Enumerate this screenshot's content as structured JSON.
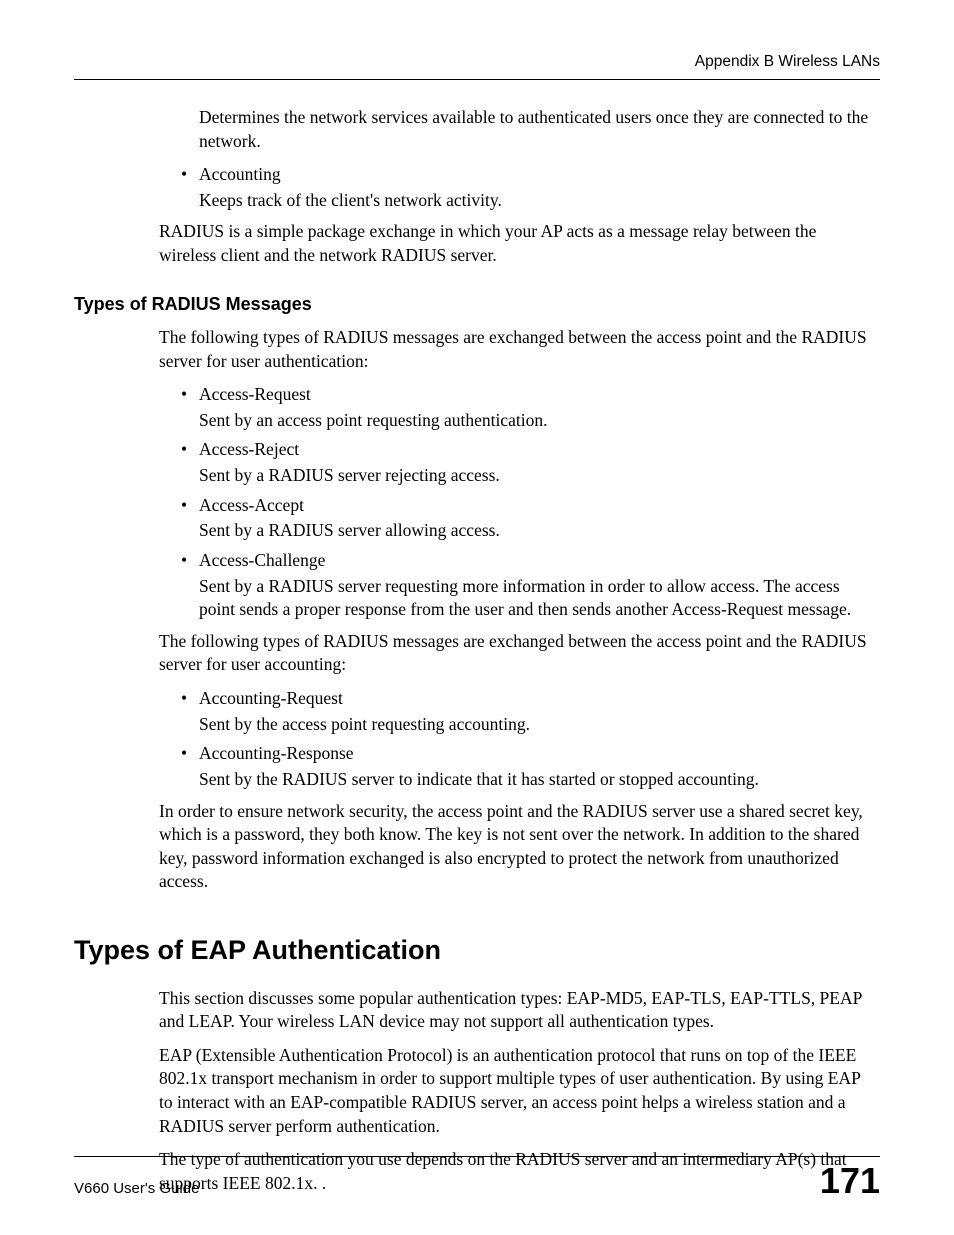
{
  "header": {
    "running": "Appendix B Wireless LANs"
  },
  "top": {
    "determines": "Determines the network services available to authenticated users once they are connected to the network.",
    "accounting_term": "Accounting",
    "accounting_desc": "Keeps track of the client's network activity.",
    "radius_intro": "RADIUS is a simple package exchange in which your AP acts as a message relay between the wireless client and the network RADIUS server."
  },
  "radius_messages": {
    "heading": "Types of RADIUS Messages",
    "intro_auth": "The following types of RADIUS messages are exchanged between the access point and the RADIUS server for user authentication:",
    "auth_items": [
      {
        "term": "Access-Request",
        "desc": "Sent by an access point requesting authentication."
      },
      {
        "term": "Access-Reject",
        "desc": "Sent by a RADIUS server rejecting access."
      },
      {
        "term": "Access-Accept",
        "desc": "Sent by a RADIUS server allowing access."
      },
      {
        "term": "Access-Challenge",
        "desc": "Sent by a RADIUS server requesting more information in order to allow access. The access point sends a proper response from the user and then sends another Access-Request message."
      }
    ],
    "intro_acct": "The following types of RADIUS messages are exchanged between the access point and the RADIUS server for user accounting:",
    "acct_items": [
      {
        "term": "Accounting-Request",
        "desc": "Sent by the access point requesting accounting."
      },
      {
        "term": "Accounting-Response",
        "desc": "Sent by the RADIUS server to indicate that it has started or stopped accounting."
      }
    ],
    "security_para": "In order to ensure network security, the access point and the RADIUS server use a shared secret key, which is a password, they both know. The key is not sent over the network. In addition to the shared key, password information exchanged is also encrypted to protect the network from unauthorized access."
  },
  "eap": {
    "heading": "Types of EAP Authentication",
    "p1": "This section discusses some popular authentication types: EAP-MD5, EAP-TLS, EAP-TTLS, PEAP and LEAP. Your wireless LAN device may not support all authentication types.",
    "p2": "EAP (Extensible Authentication Protocol) is an authentication protocol that runs on top of the IEEE 802.1x transport mechanism in order to support multiple types of user authentication. By using EAP to interact with an EAP-compatible RADIUS server, an access point helps a wireless station and a RADIUS server perform authentication.",
    "p3": "The type of authentication you use depends on the RADIUS server and an intermediary AP(s) that supports IEEE 802.1x. ."
  },
  "footer": {
    "guide": "V660 User's Guide",
    "page": "171"
  }
}
